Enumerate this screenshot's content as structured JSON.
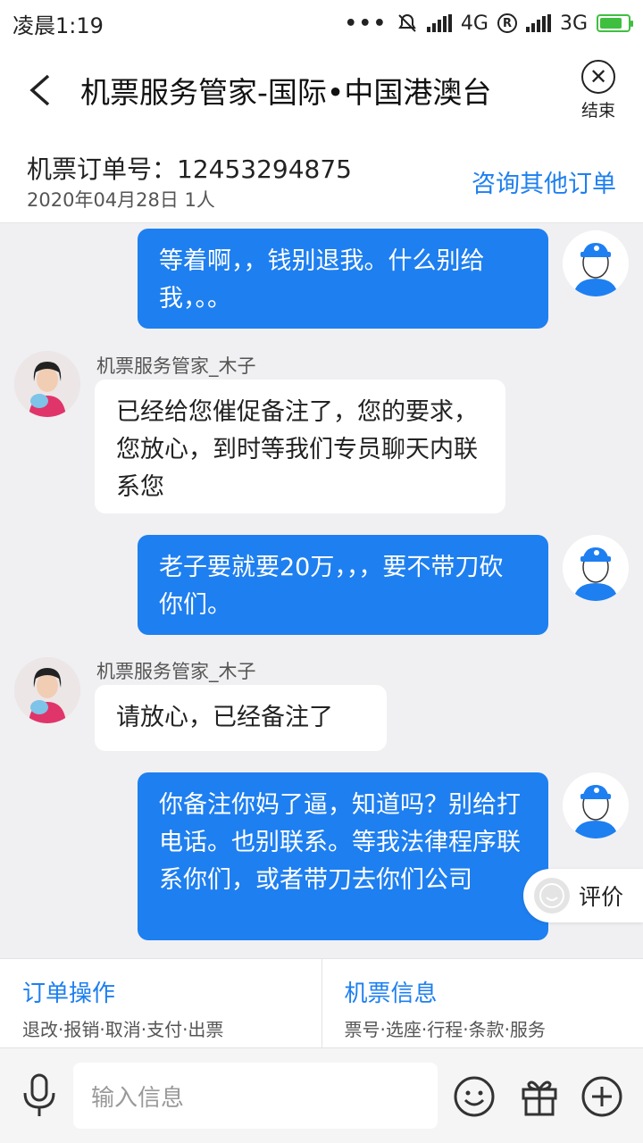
{
  "status_bar": {
    "time": "凌晨1:19",
    "network1": "4G",
    "network2": "3G",
    "r_badge": "R"
  },
  "header": {
    "title": "机票服务管家-国际•中国港澳台",
    "end_label": "结束"
  },
  "order": {
    "number_label": "机票订单号：12453294875",
    "meta": "2020年04月28日 1人",
    "consult_link": "咨询其他订单"
  },
  "messages": [
    {
      "from": "user",
      "text": "等着啊，，钱别退我。什么别给我，。。"
    },
    {
      "from": "agent",
      "name": "机票服务管家_木子",
      "text": "已经给您催促备注了，您的要求，您放心，到时等我们专员聊天内联系您"
    },
    {
      "from": "user",
      "text": "老子要就要20万，，，要不带刀砍你们。"
    },
    {
      "from": "agent",
      "name": "机票服务管家_木子",
      "text": "请放心，已经备注了"
    },
    {
      "from": "user",
      "text": "你备注你妈了逼，知道吗？别给打电话。也别联系。等我法律程序联系你们，或者带刀去你们公司"
    }
  ],
  "rate_button": "评价",
  "quick_actions": [
    {
      "title": "订单操作",
      "sub": "退改·报销·取消·支付·出票"
    },
    {
      "title": "机票信息",
      "sub": "票号·选座·行程·条款·服务"
    }
  ],
  "input": {
    "placeholder": "输入信息"
  },
  "icons": [
    "back-chevron-icon",
    "close-circle-icon",
    "microphone-icon",
    "emoji-icon",
    "gift-icon",
    "plus-circle-icon"
  ],
  "colors": {
    "accent": "#1e7ff0",
    "battery": "#3fbf3f"
  }
}
